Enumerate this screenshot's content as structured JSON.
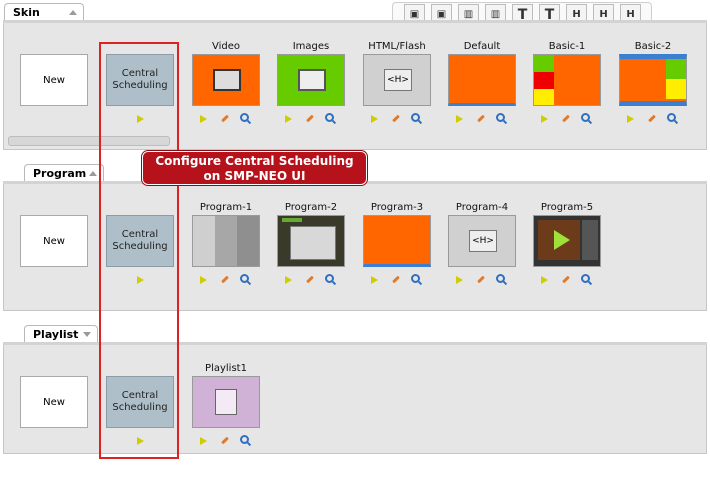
{
  "sections": {
    "skin": {
      "tab": "Skin"
    },
    "program": {
      "tab": "Program"
    },
    "playlist": {
      "tab": "Playlist"
    }
  },
  "common": {
    "new_label": "New",
    "central_label": "Central Scheduling"
  },
  "skin_items": [
    "Video",
    "Images",
    "HTML/Flash",
    "Default",
    "Basic-1",
    "Basic-2"
  ],
  "program_items": [
    "Program-1",
    "Program-2",
    "Program-3",
    "Program-4",
    "Program-5"
  ],
  "playlist_items": [
    "Playlist1"
  ],
  "toolbar_buttons": [
    "layout-1-icon",
    "layout-2-icon",
    "column-1-icon",
    "column-2-icon",
    "text-1-icon",
    "text-2-icon",
    "heading-1-icon",
    "heading-2-icon",
    "heading-3-icon"
  ],
  "callout": {
    "line1": "Configure Central Scheduling",
    "line2": "on SMP-NEO UI"
  },
  "colors": {
    "accent_red": "#b5121b",
    "orange": "#ff6600",
    "green": "#66cc00",
    "central": "#aebfc9"
  }
}
